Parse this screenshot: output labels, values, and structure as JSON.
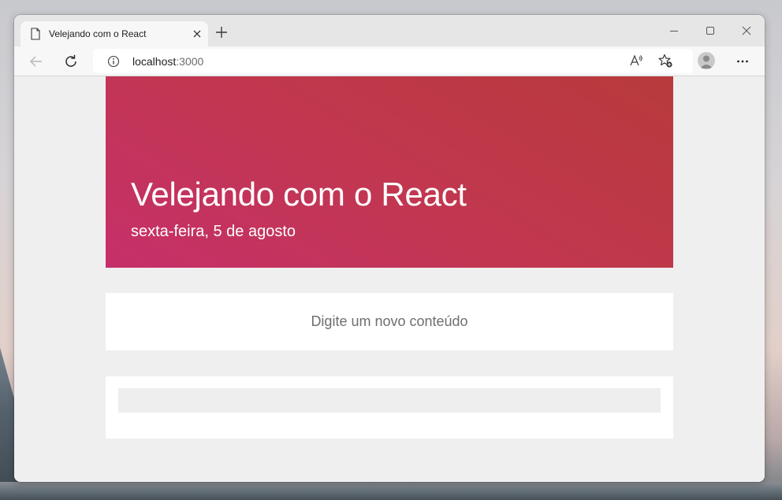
{
  "browser": {
    "tab": {
      "title": "Velejando com o React",
      "icon": "page-icon"
    },
    "address": {
      "host": "localhost",
      "port": ":3000"
    },
    "icons": {
      "back": "back-arrow-icon",
      "refresh": "refresh-icon",
      "info": "info-icon",
      "read_aloud": "read-aloud-icon",
      "favorites": "add-favorite-icon",
      "profile": "profile-icon",
      "menu": "more-menu-icon"
    }
  },
  "hero": {
    "title": "Velejando com o React",
    "date": "sexta-feira, 5 de agosto",
    "gradient": [
      "#c6306a",
      "#b83a3c"
    ]
  },
  "composer": {
    "placeholder": "Digite um novo conteúdo",
    "value": ""
  },
  "list": {
    "items": [
      ""
    ]
  },
  "colors": {
    "page_bg": "#efefef",
    "card_bg": "#ffffff",
    "list_item_bg": "#eeeeee"
  }
}
